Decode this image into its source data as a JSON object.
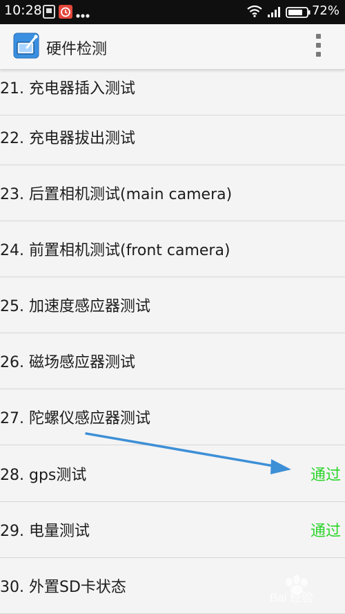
{
  "status_bar": {
    "time": "10:28",
    "battery_percent": "72%",
    "icons": [
      "gallery-icon",
      "alarm-icon",
      "more-dots-icon",
      "wifi-icon",
      "signal-icon",
      "battery-icon"
    ]
  },
  "app_bar": {
    "title": "硬件检测",
    "icon": "hardware-test-app-icon",
    "menu_icon": "overflow-menu-icon"
  },
  "list": {
    "items": [
      {
        "label": "21. 充电器插入测试",
        "status": ""
      },
      {
        "label": "22. 充电器拔出测试",
        "status": ""
      },
      {
        "label": "23. 后置相机测试(main camera)",
        "status": ""
      },
      {
        "label": "24. 前置相机测试(front camera)",
        "status": ""
      },
      {
        "label": "25. 加速度感应器测试",
        "status": ""
      },
      {
        "label": "26. 磁场感应器测试",
        "status": ""
      },
      {
        "label": "27. 陀螺仪感应器测试",
        "status": ""
      },
      {
        "label": "28. gps测试",
        "status": "通过"
      },
      {
        "label": "29. 电量测试",
        "status": "通过"
      },
      {
        "label": "30. 外置SD卡状态",
        "status": ""
      }
    ]
  },
  "colors": {
    "pass": "#2ad42a",
    "arrow": "#3d8fd6"
  },
  "annotation": {
    "icon": "blue-arrow-annotation"
  },
  "watermark": {
    "text": "Bai 经验"
  }
}
